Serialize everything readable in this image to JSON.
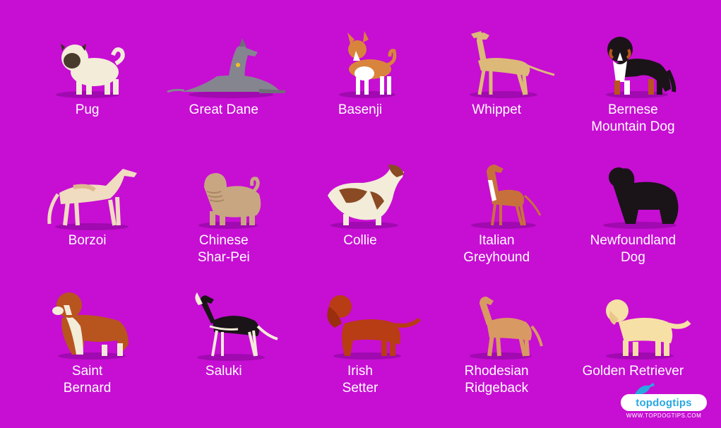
{
  "breeds": [
    {
      "label": "Pug"
    },
    {
      "label": "Great Dane"
    },
    {
      "label": "Basenji"
    },
    {
      "label": "Whippet"
    },
    {
      "label": "Bernese\nMountain Dog"
    },
    {
      "label": "Borzoi"
    },
    {
      "label": "Chinese\nShar-Pei"
    },
    {
      "label": "Collie"
    },
    {
      "label": "Italian\nGreyhound"
    },
    {
      "label": "Newfoundland\nDog"
    },
    {
      "label": "Saint\nBernard"
    },
    {
      "label": "Saluki"
    },
    {
      "label": "Irish\nSetter"
    },
    {
      "label": "Rhodesian\nRidgeback"
    },
    {
      "label": "Golden Retriever"
    }
  ],
  "logo": {
    "brand": "topdogtips",
    "url": "WWW.TOPDOGTIPS.COM"
  },
  "colors": {
    "background": "#c70ed3",
    "shadow": "#a00ab0",
    "label": "#ffffff"
  }
}
